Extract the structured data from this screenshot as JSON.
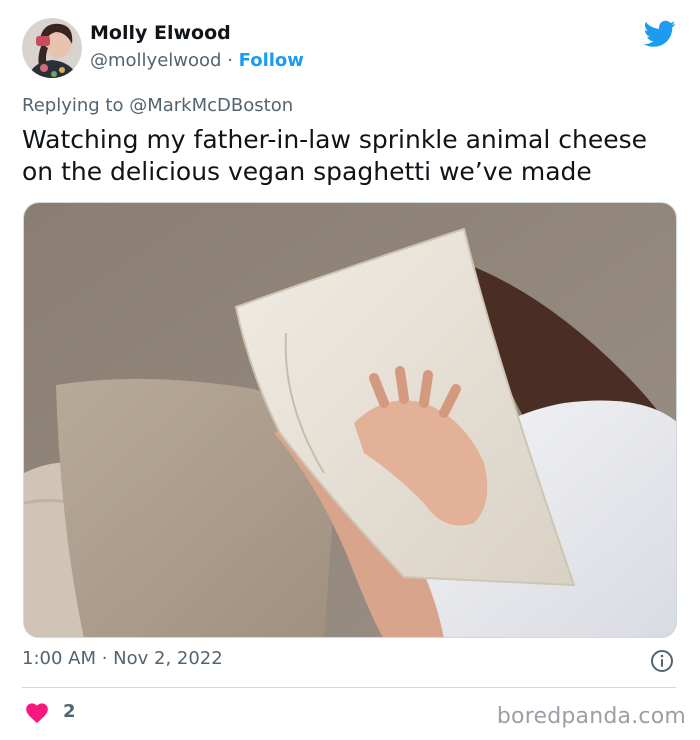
{
  "author": {
    "name": "Molly Elwood",
    "handle": "@mollyelwood",
    "separator": "·",
    "follow_label": "Follow",
    "avatar_icon": "user-avatar"
  },
  "platform_icon": "twitter-bird-icon",
  "reply": {
    "prefix": "Replying to",
    "mention": "@MarkMcDBoston"
  },
  "tweet_text": "Watching my father-in-law sprinkle animal cheese on the delicious vegan spaghetti we’ve made",
  "timestamp": "1:00 AM · Nov 2, 2022",
  "likes": {
    "count": "2",
    "icon": "heart-icon"
  },
  "watermark": "boredpanda.com",
  "colors": {
    "accent": "#1d9bf0",
    "like": "#f91880",
    "secondary_text": "#536471"
  }
}
